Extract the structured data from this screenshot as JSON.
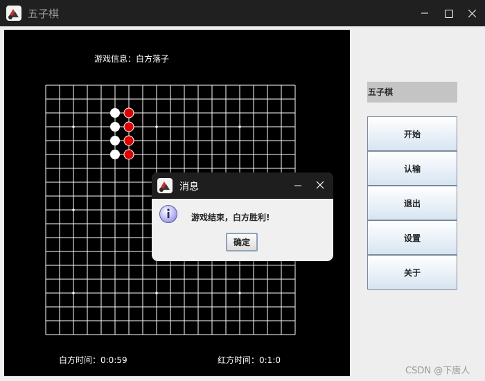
{
  "window": {
    "title": "五子棋"
  },
  "board": {
    "info_text": "游戏信息：白方落子",
    "white_time": "白方时间：0:0:59",
    "red_time": "红方时间：0:1:0",
    "grid_lines": 19,
    "line_color": "#ffffff",
    "background": "#000000",
    "stones": [
      {
        "col": 5,
        "row": 2,
        "color": "white"
      },
      {
        "col": 6,
        "row": 2,
        "color": "red"
      },
      {
        "col": 5,
        "row": 3,
        "color": "white"
      },
      {
        "col": 6,
        "row": 3,
        "color": "red"
      },
      {
        "col": 5,
        "row": 4,
        "color": "white"
      },
      {
        "col": 6,
        "row": 4,
        "color": "red"
      },
      {
        "col": 5,
        "row": 5,
        "color": "white"
      },
      {
        "col": 6,
        "row": 5,
        "color": "red"
      }
    ],
    "star_points": [
      {
        "col": 2,
        "row": 3
      },
      {
        "col": 8,
        "row": 3
      },
      {
        "col": 14,
        "row": 3
      },
      {
        "col": 2,
        "row": 9
      },
      {
        "col": 8,
        "row": 9
      },
      {
        "col": 14,
        "row": 9
      },
      {
        "col": 2,
        "row": 15
      },
      {
        "col": 8,
        "row": 15
      },
      {
        "col": 14,
        "row": 15
      }
    ]
  },
  "sidebar": {
    "label": "五子棋",
    "buttons": [
      "开始",
      "认输",
      "退出",
      "设置",
      "关于"
    ]
  },
  "dialog": {
    "title": "消息",
    "message": "游戏结束，白方胜利!",
    "ok_label": "确定",
    "icon": "info-icon"
  },
  "watermark": "CSDN @下唐人",
  "colors": {
    "red_stone": "#e00000",
    "white_stone": "#ffffff",
    "button_gradient_bottom": "#d7e5f2"
  }
}
